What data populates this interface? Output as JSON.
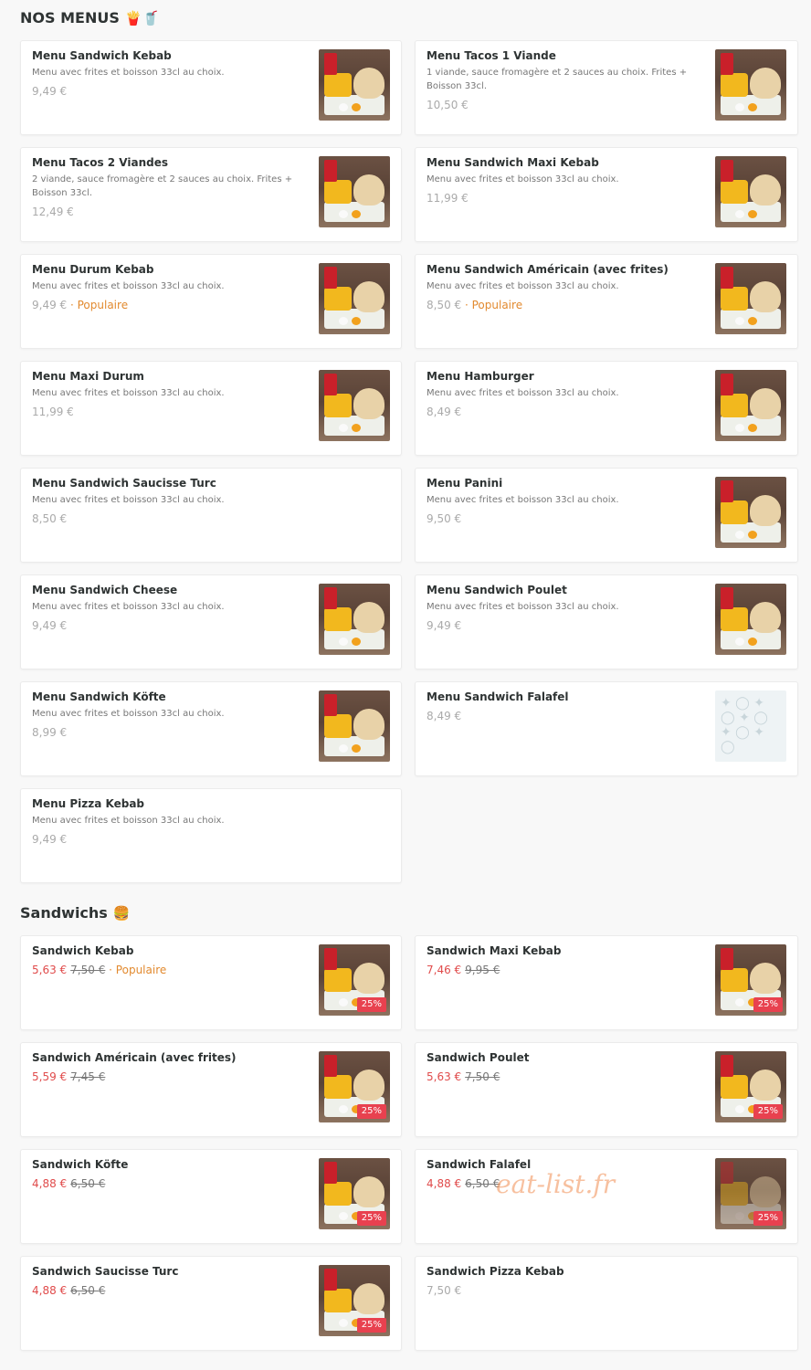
{
  "menus": {
    "title": "NOS MENUS",
    "emoji": "🍟🥤",
    "items": [
      {
        "name": "Menu Sandwich Kebab",
        "desc": "Menu avec frites et boisson 33cl au choix.",
        "price": "9,49 €",
        "popular": "",
        "image": "kebab-meal"
      },
      {
        "name": "Menu Tacos 1 Viande",
        "desc": "1 viande, sauce fromagère et 2 sauces au choix. Frites + Boisson 33cl.",
        "price": "10,50 €",
        "popular": "",
        "image": "tacos-meal"
      },
      {
        "name": "Menu Tacos 2 Viandes",
        "desc": "2 viande, sauce fromagère et 2 sauces au choix. Frites + Boisson 33cl.",
        "price": "12,49 €",
        "popular": "",
        "image": "tacos-meal"
      },
      {
        "name": "Menu Sandwich Maxi Kebab",
        "desc": "Menu avec frites et boisson 33cl au choix.",
        "price": "11,99 €",
        "popular": "",
        "image": "kebab-meal"
      },
      {
        "name": "Menu Durum Kebab",
        "desc": "Menu avec frites et boisson 33cl au choix.",
        "price": "9,49 €",
        "popular": "Populaire",
        "image": "durum-meal"
      },
      {
        "name": "Menu Sandwich Américain (avec frites)",
        "desc": "Menu avec frites et boisson 33cl au choix.",
        "price": "8,50 €",
        "popular": "Populaire",
        "image": "american-meal"
      },
      {
        "name": "Menu Maxi Durum",
        "desc": "Menu avec frites et boisson 33cl au choix.",
        "price": "11,99 €",
        "popular": "",
        "image": "durum-meal"
      },
      {
        "name": "Menu Hamburger",
        "desc": "Menu avec frites et boisson 33cl au choix.",
        "price": "8,49 €",
        "popular": "",
        "image": "burger-meal"
      },
      {
        "name": "Menu Sandwich Saucisse Turc",
        "desc": "Menu avec frites et boisson 33cl au choix.",
        "price": "8,50 €",
        "popular": "",
        "image": ""
      },
      {
        "name": "Menu Panini",
        "desc": "Menu avec frites et boisson 33cl au choix.",
        "price": "9,50 €",
        "popular": "",
        "image": "panini-meal"
      },
      {
        "name": "Menu Sandwich Cheese",
        "desc": "Menu avec frites et boisson 33cl au choix.",
        "price": "9,49 €",
        "popular": "",
        "image": "cheese-meal"
      },
      {
        "name": "Menu Sandwich Poulet",
        "desc": "Menu avec frites et boisson 33cl au choix.",
        "price": "9,49 €",
        "popular": "",
        "image": "chicken-meal"
      },
      {
        "name": "Menu Sandwich Köfte",
        "desc": "Menu avec frites et boisson 33cl au choix.",
        "price": "8,99 €",
        "popular": "",
        "image": "kofte-meal"
      },
      {
        "name": "Menu Sandwich Falafel",
        "desc": "",
        "price": "8,49 €",
        "popular": "",
        "image": "placeholder"
      },
      {
        "name": "Menu Pizza Kebab",
        "desc": "Menu avec frites et boisson 33cl au choix.",
        "price": "9,49 €",
        "popular": "",
        "image": ""
      }
    ]
  },
  "sandwichs": {
    "title": "Sandwichs",
    "emoji": "🍔",
    "items": [
      {
        "name": "Sandwich Kebab",
        "price": "5,63 €",
        "old_price": "7,50 €",
        "popular": "Populaire",
        "badge": "25%",
        "image": "kebab"
      },
      {
        "name": "Sandwich Maxi Kebab",
        "price": "7,46 €",
        "old_price": "9,95 €",
        "popular": "",
        "badge": "25%",
        "image": "kebab"
      },
      {
        "name": "Sandwich Américain (avec frites)",
        "price": "5,59 €",
        "old_price": "7,45 €",
        "popular": "",
        "badge": "25%",
        "image": "american"
      },
      {
        "name": "Sandwich Poulet",
        "price": "5,63 €",
        "old_price": "7,50 €",
        "popular": "",
        "badge": "25%",
        "image": "chicken"
      },
      {
        "name": "Sandwich Köfte",
        "price": "4,88 €",
        "old_price": "6,50 €",
        "popular": "",
        "badge": "25%",
        "image": "kofte"
      },
      {
        "name": "Sandwich Falafel",
        "price": "4,88 €",
        "old_price": "6,50 €",
        "popular": "",
        "badge": "25%",
        "image": "falafel-faded"
      },
      {
        "name": "Sandwich Saucisse Turc",
        "price": "4,88 €",
        "old_price": "6,50 €",
        "popular": "",
        "badge": "25%",
        "image": "sausage"
      },
      {
        "name": "Sandwich Pizza Kebab",
        "price": "7,50 €",
        "old_price": "",
        "popular": "",
        "badge": "",
        "image": ""
      }
    ]
  },
  "watermark": "eat-list.fr",
  "colors": {
    "accent_popular": "#e28a2f",
    "discount_price": "#e04b4b",
    "badge": "#e8414f"
  }
}
